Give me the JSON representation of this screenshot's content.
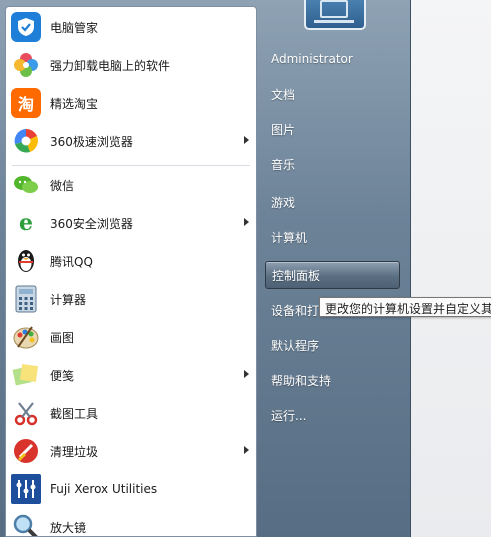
{
  "left_items": [
    {
      "label": "电脑管家",
      "icon": "shield-icon",
      "arrow": false
    },
    {
      "label": "强力卸载电脑上的软件",
      "icon": "flower-icon",
      "arrow": false
    },
    {
      "label": "精选淘宝",
      "icon": "taobao-icon",
      "glyph": "淘",
      "arrow": false
    },
    {
      "label": "360极速浏览器",
      "icon": "360-chrome-icon",
      "arrow": true
    },
    {
      "label": "微信",
      "icon": "wechat-icon",
      "arrow": false
    },
    {
      "label": "360安全浏览器",
      "icon": "360-ie-icon",
      "glyph": "e",
      "arrow": true
    },
    {
      "label": "腾讯QQ",
      "icon": "qq-penguin-icon",
      "arrow": false
    },
    {
      "label": "计算器",
      "icon": "calculator-icon",
      "arrow": false
    },
    {
      "label": "画图",
      "icon": "paint-palette-icon",
      "arrow": false
    },
    {
      "label": "便笺",
      "icon": "sticky-notes-icon",
      "arrow": true
    },
    {
      "label": "截图工具",
      "icon": "scissors-icon",
      "arrow": false
    },
    {
      "label": "清理垃圾",
      "icon": "cleaner-icon",
      "arrow": true
    },
    {
      "label": "Fuji Xerox Utilities",
      "icon": "fuji-xerox-icon",
      "arrow": false
    },
    {
      "label": "放大镜",
      "icon": "magnifier-icon",
      "arrow": false
    }
  ],
  "right_items": [
    {
      "label": "Administrator"
    },
    {
      "label": "文档"
    },
    {
      "label": "图片"
    },
    {
      "label": "音乐"
    },
    {
      "label": "游戏"
    },
    {
      "label": "计算机"
    },
    {
      "label": "控制面板"
    },
    {
      "label": "设备和打"
    },
    {
      "label": "默认程序"
    },
    {
      "label": "帮助和支持"
    },
    {
      "label": "运行..."
    }
  ],
  "tooltip": "更改您的计算机设置并自定义其",
  "colors": {
    "accent": "#1e88d6",
    "menu_bg": "#6d8398",
    "highlight": "#5b6f83"
  }
}
